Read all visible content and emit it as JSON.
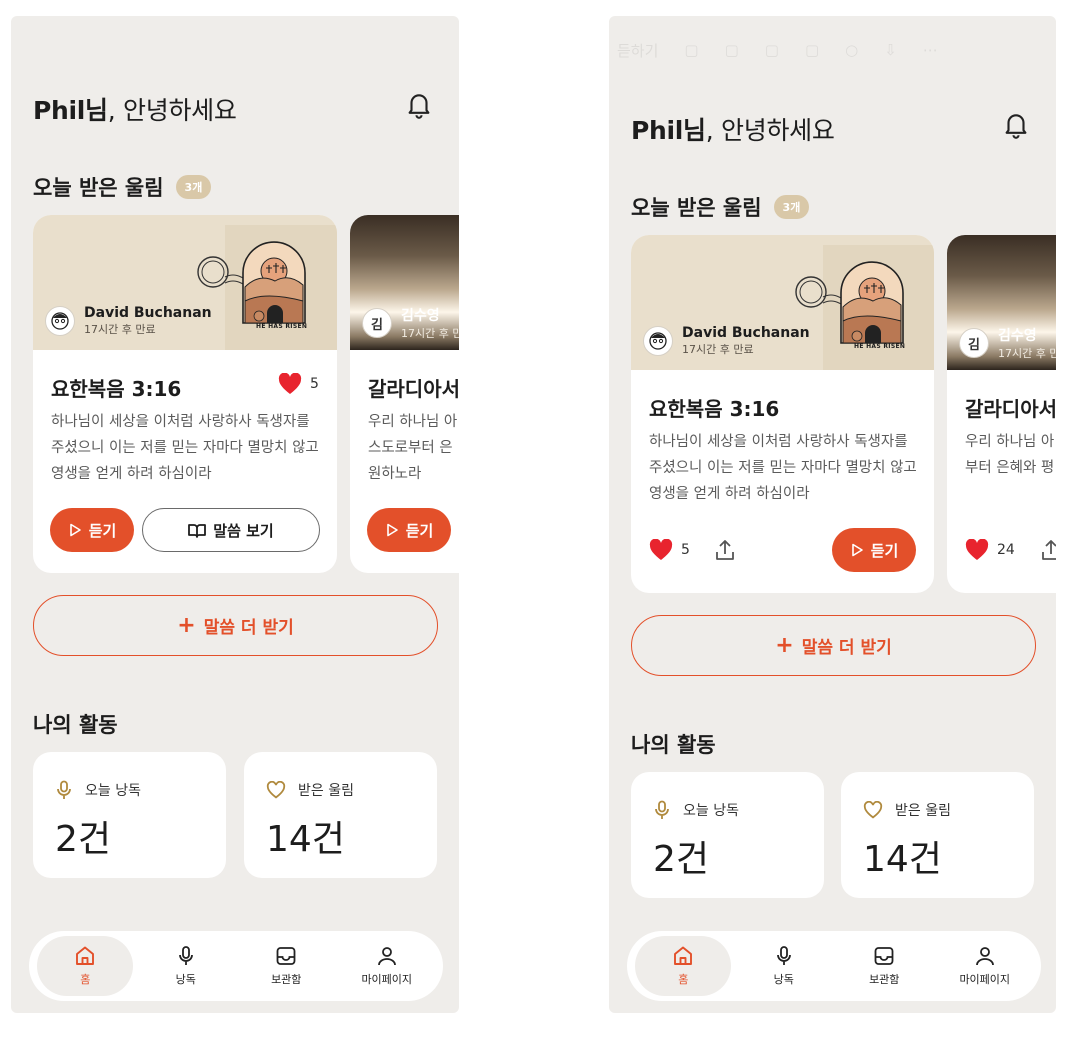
{
  "left": {
    "greeting_name": "Phil님",
    "greeting_rest": ", 안녕하세요",
    "section_received": "오늘 받은 울림",
    "received_count": "3개",
    "cards": [
      {
        "sender": "David Buchanan",
        "expiry": "17시간 후 만료",
        "verse": "요한복음 3:16",
        "likes": "5",
        "text": "하나님이 세상을 이처럼 사랑하사 독생자를 주셨으니 이는 저를 믿는 자마다 멸망치 않고 영생을 얻게 하려 하심이라",
        "listen": "듣기",
        "read": "말씀 보기"
      },
      {
        "avatar": "김",
        "sender": "김수영",
        "expiry": "17시간 후 만",
        "verse": "갈라디아서",
        "text": "우리 하나님 아\n스도로부터 은\n원하노라",
        "listen": "듣기"
      }
    ],
    "more_button": "말씀 더 받기",
    "section_activity": "나의 활동",
    "stats": [
      {
        "label": "오늘 낭독",
        "value": "2건"
      },
      {
        "label": "받은 울림",
        "value": "14건"
      }
    ],
    "tabs": [
      "홈",
      "낭독",
      "보관함",
      "마이페이지"
    ]
  },
  "right": {
    "ghost_toolbar": "듣하기",
    "greeting_name": "Phil님",
    "greeting_rest": ", 안녕하세요",
    "section_received": "오늘 받은 울림",
    "received_count": "3개",
    "cards": [
      {
        "sender": "David Buchanan",
        "expiry": "17시간 후 만료",
        "verse": "요한복음 3:16",
        "likes": "5",
        "text": "하나님이 세상을 이처럼 사랑하사 독생자를 주셨으니 이는 저를 믿는 자마다 멸망치 않고 영생을 얻게 하려 하심이라",
        "listen": "듣기"
      },
      {
        "avatar": "김",
        "sender": "김수영",
        "expiry": "17시간 후 만",
        "verse": "갈라디아서",
        "text": "우리 하나님 아\n부터 은혜와 평",
        "likes": "24"
      }
    ],
    "more_button": "말씀 더 받기",
    "section_activity": "나의 활동",
    "stats": [
      {
        "label": "오늘 낭독",
        "value": "2건"
      },
      {
        "label": "받은 울림",
        "value": "14건"
      }
    ],
    "tabs": [
      "홈",
      "낭독",
      "보관함",
      "마이페이지"
    ]
  },
  "colors": {
    "accent": "#e3502a",
    "background": "#efedea",
    "badge": "#d9c8a8"
  },
  "card_art_caption": "HE HAS RISEN"
}
